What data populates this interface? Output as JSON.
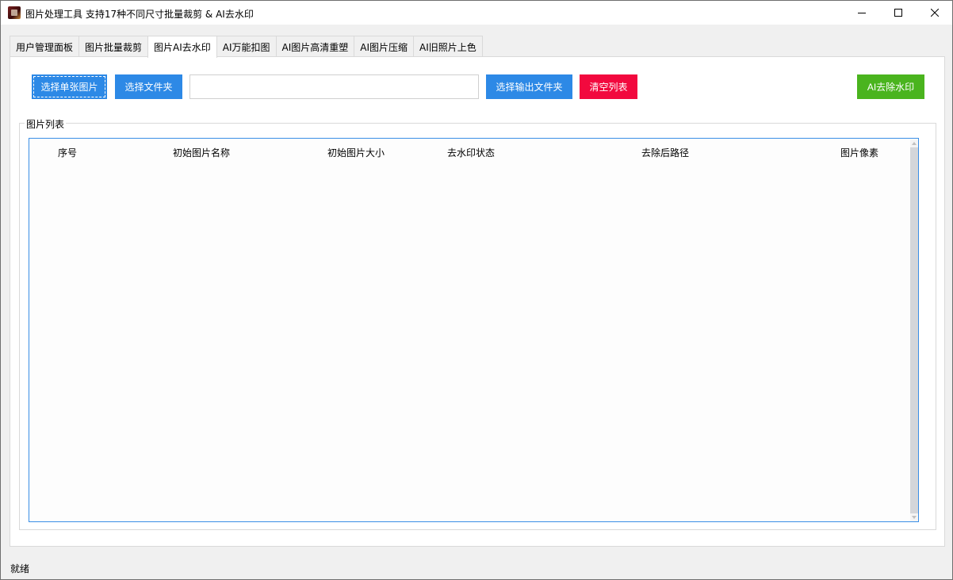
{
  "window": {
    "title": "图片处理工具 支持17种不同尺寸批量裁剪 & AI去水印"
  },
  "tabs": [
    {
      "label": "用户管理面板"
    },
    {
      "label": "图片批量裁剪"
    },
    {
      "label": "图片AI去水印",
      "active": true
    },
    {
      "label": "AI万能扣图"
    },
    {
      "label": "AI图片高清重塑"
    },
    {
      "label": "AI图片压缩"
    },
    {
      "label": "AI旧照片上色"
    }
  ],
  "toolbar": {
    "select_single": "选择单张图片",
    "select_folder": "选择文件夹",
    "path_value": "",
    "select_output": "选择输出文件夹",
    "clear_list": "清空列表",
    "remove_watermark": "AI去除水印"
  },
  "image_list": {
    "group_title": "图片列表",
    "columns": [
      "序号",
      "初始图片名称",
      "初始图片大小",
      "去水印状态",
      "去除后路径",
      "图片像素"
    ],
    "rows": []
  },
  "status": {
    "text": "就绪"
  },
  "colors": {
    "blue_button": "#2d89e6",
    "red_button": "#f2093e",
    "green_button": "#4ab41e",
    "list_border": "#3a8ee6"
  }
}
